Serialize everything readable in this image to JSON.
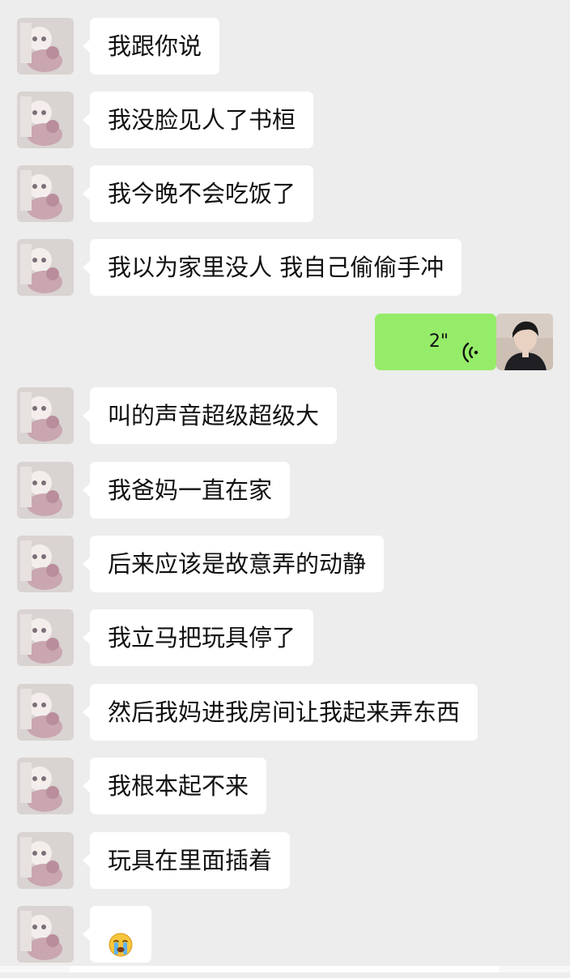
{
  "messages": [
    {
      "side": "in",
      "text": "我跟你说"
    },
    {
      "side": "in",
      "text": "我没脸见人了书桓"
    },
    {
      "side": "in",
      "text": "我今晚不会吃饭了"
    },
    {
      "side": "in",
      "text": "我以为家里没人 我自己偷偷手冲"
    },
    {
      "side": "out",
      "type": "voice",
      "duration": "2\""
    },
    {
      "side": "in",
      "text": "叫的声音超级超级大"
    },
    {
      "side": "in",
      "text": "我爸妈一直在家"
    },
    {
      "side": "in",
      "text": "后来应该是故意弄的动静"
    },
    {
      "side": "in",
      "text": "我立马把玩具停了"
    },
    {
      "side": "in",
      "text": "然后我妈进我房间让我起来弄东西"
    },
    {
      "side": "in",
      "text": "我根本起不来"
    },
    {
      "side": "in",
      "text": "玩具在里面插着"
    },
    {
      "side": "in",
      "type": "emoji",
      "emoji_name": "crying-face-emoji"
    }
  ],
  "colors": {
    "background": "#ededed",
    "incoming_bubble": "#ffffff",
    "outgoing_bubble": "#95ec69"
  },
  "icons": {
    "voice": "voice-wave-icon",
    "emoji": "crying-face-emoji"
  }
}
